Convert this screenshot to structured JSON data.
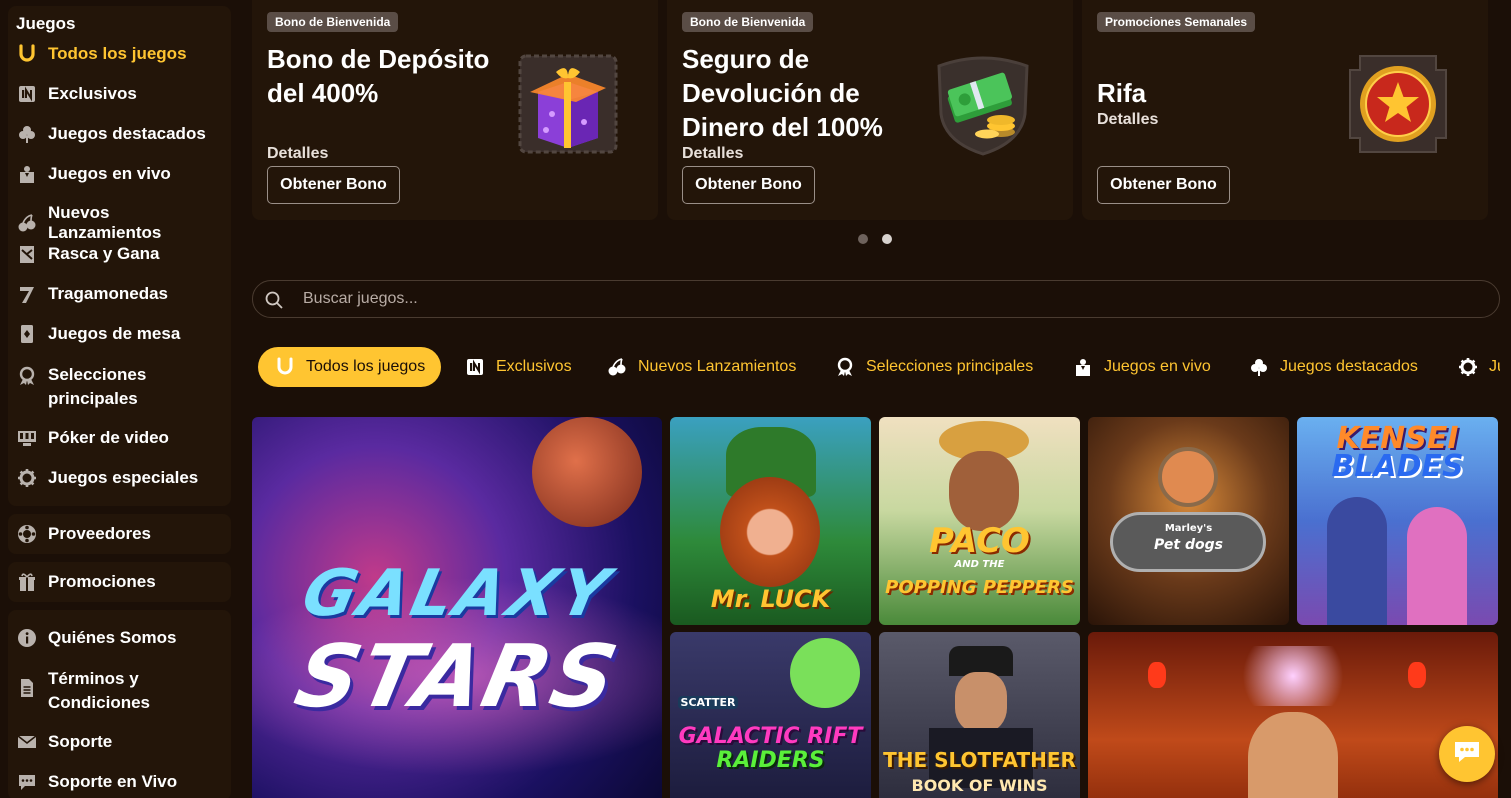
{
  "sidebar": {
    "title": "Juegos",
    "items": [
      {
        "label": "Todos los juegos",
        "icon": "horseshoe-icon"
      },
      {
        "label": "Exclusivos",
        "icon": "in-badge-icon"
      },
      {
        "label": "Juegos destacados",
        "icon": "clover-icon"
      },
      {
        "label": "Juegos en vivo",
        "icon": "dealer-icon"
      },
      {
        "label": "Nuevos Lanzamientos",
        "icon": "cherries-icon"
      },
      {
        "label": "Rasca y Gana",
        "icon": "scratch-card-icon"
      },
      {
        "label": "Tragamonedas",
        "icon": "seven-icon"
      },
      {
        "label": "Juegos de mesa",
        "icon": "playing-card-icon"
      },
      {
        "label": "Selecciones principales",
        "icon": "award-icon"
      },
      {
        "label": "Póker de video",
        "icon": "video-poker-icon"
      },
      {
        "label": "Juegos especiales",
        "icon": "gear-icon"
      }
    ],
    "providers": {
      "label": "Proveedores",
      "icon": "chip-icon"
    },
    "promotions": {
      "label": "Promociones",
      "icon": "gift-icon"
    },
    "info": [
      {
        "label": "Quiénes Somos",
        "icon": "info-icon"
      },
      {
        "label": "Términos y Condiciones",
        "icon": "document-icon"
      },
      {
        "label": "Soporte",
        "icon": "mail-icon"
      },
      {
        "label": "Soporte en Vivo",
        "icon": "chat-icon"
      }
    ]
  },
  "promos": [
    {
      "badge": "Bono de Bienvenida",
      "title": "Bono de Depósito del 400%",
      "details": "Detalles",
      "button": "Obtener Bono",
      "art": "gift-box-icon"
    },
    {
      "badge": "Bono de Bienvenida",
      "title": "Seguro de Devolución de Dinero del 100%",
      "details": "Detalles",
      "button": "Obtener Bono",
      "art": "cash-coins-icon"
    },
    {
      "badge": "Promociones Semanales",
      "title": "Rifa",
      "details": "Detalles",
      "button": "Obtener Bono",
      "art": "star-medal-icon"
    }
  ],
  "carousel": {
    "pages": 2,
    "active": 2
  },
  "search": {
    "placeholder": "Buscar juegos..."
  },
  "tabs": [
    {
      "label": "Todos los juegos",
      "icon": "horseshoe-icon",
      "active": true
    },
    {
      "label": "Exclusivos",
      "icon": "in-badge-icon"
    },
    {
      "label": "Nuevos Lanzamientos",
      "icon": "cherries-icon"
    },
    {
      "label": "Selecciones principales",
      "icon": "award-icon"
    },
    {
      "label": "Juegos en vivo",
      "icon": "dealer-icon"
    },
    {
      "label": "Juegos destacados",
      "icon": "clover-icon"
    },
    {
      "label": "Ju",
      "icon": "gear-icon"
    }
  ],
  "games": [
    {
      "title_line1": "GALAXY",
      "title_line2": "STARS"
    },
    {
      "title_line1": "Mr. LUCK"
    },
    {
      "title_line1": "PACO",
      "title_line2": "AND THE",
      "title_line3": "POPPING PEPPERS"
    },
    {
      "title_line1": "Marley's",
      "title_line2": "Pet dogs"
    },
    {
      "title_line1": "KENSEI",
      "title_line2": "BLADES"
    },
    {
      "title_line1": "SCATTER",
      "title_line2": "GALACTIC RIFT",
      "title_line3": "RAIDERS"
    },
    {
      "title_line1": "THE SLOTFATHER",
      "title_line2": "BOOK OF WINS"
    },
    {
      "title_line1": ""
    }
  ],
  "colors": {
    "accent": "#ffc531",
    "background": "#1b0f07",
    "panel": "#231509"
  }
}
